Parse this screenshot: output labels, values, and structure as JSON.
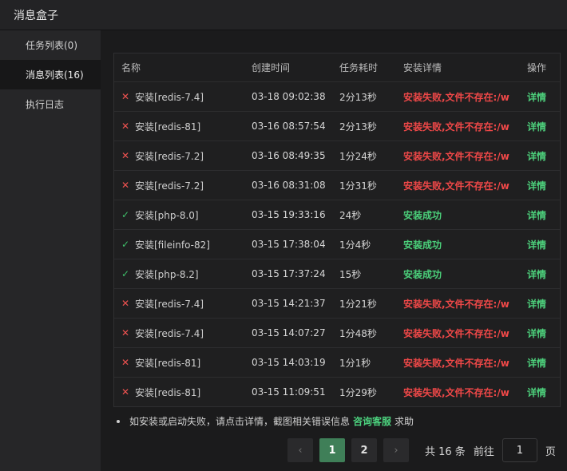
{
  "window": {
    "title": "消息盒子"
  },
  "sidebar": {
    "items": [
      {
        "label": "任务列表(0)"
      },
      {
        "label": "消息列表(16)"
      },
      {
        "label": "执行日志"
      }
    ]
  },
  "table": {
    "headers": {
      "name": "名称",
      "created": "创建时间",
      "duration": "任务耗时",
      "detail": "安装详情",
      "action": "操作"
    },
    "rows": [
      {
        "status": "fail",
        "icon": "✕",
        "name": "安装[redis-7.4]",
        "created": "03-18 09:02:38",
        "duration": "2分13秒",
        "detail": "安装失败,文件不存在:/w",
        "action": "详情"
      },
      {
        "status": "fail",
        "icon": "✕",
        "name": "安装[redis-81]",
        "created": "03-16 08:57:54",
        "duration": "2分13秒",
        "detail": "安装失败,文件不存在:/w",
        "action": "详情"
      },
      {
        "status": "fail",
        "icon": "✕",
        "name": "安装[redis-7.2]",
        "created": "03-16 08:49:35",
        "duration": "1分24秒",
        "detail": "安装失败,文件不存在:/w",
        "action": "详情"
      },
      {
        "status": "fail",
        "icon": "✕",
        "name": "安装[redis-7.2]",
        "created": "03-16 08:31:08",
        "duration": "1分31秒",
        "detail": "安装失败,文件不存在:/w",
        "action": "详情"
      },
      {
        "status": "ok",
        "icon": "✓",
        "name": "安装[php-8.0]",
        "created": "03-15 19:33:16",
        "duration": "24秒",
        "detail": "安装成功",
        "action": "详情"
      },
      {
        "status": "ok",
        "icon": "✓",
        "name": "安装[fileinfo-82]",
        "created": "03-15 17:38:04",
        "duration": "1分4秒",
        "detail": "安装成功",
        "action": "详情"
      },
      {
        "status": "ok",
        "icon": "✓",
        "name": "安装[php-8.2]",
        "created": "03-15 17:37:24",
        "duration": "15秒",
        "detail": "安装成功",
        "action": "详情"
      },
      {
        "status": "fail",
        "icon": "✕",
        "name": "安装[redis-7.4]",
        "created": "03-15 14:21:37",
        "duration": "1分21秒",
        "detail": "安装失败,文件不存在:/w",
        "action": "详情"
      },
      {
        "status": "fail",
        "icon": "✕",
        "name": "安装[redis-7.4]",
        "created": "03-15 14:07:27",
        "duration": "1分48秒",
        "detail": "安装失败,文件不存在:/w",
        "action": "详情"
      },
      {
        "status": "fail",
        "icon": "✕",
        "name": "安装[redis-81]",
        "created": "03-15 14:03:19",
        "duration": "1分1秒",
        "detail": "安装失败,文件不存在:/w",
        "action": "详情"
      },
      {
        "status": "fail",
        "icon": "✕",
        "name": "安装[redis-81]",
        "created": "03-15 11:09:51",
        "duration": "1分29秒",
        "detail": "安装失败,文件不存在:/w",
        "action": "详情"
      }
    ]
  },
  "tip": {
    "prefix": "如安装或启动失败，请点击详情，截图相关错误信息",
    "link": "咨询客服",
    "suffix": "求助"
  },
  "pagination": {
    "prev_icon": "‹",
    "pages": [
      "1",
      "2"
    ],
    "current": "1",
    "next_icon": "›",
    "total": "共 16 条",
    "goto_label": "前往",
    "goto_value": "1",
    "page_suffix": "页"
  }
}
